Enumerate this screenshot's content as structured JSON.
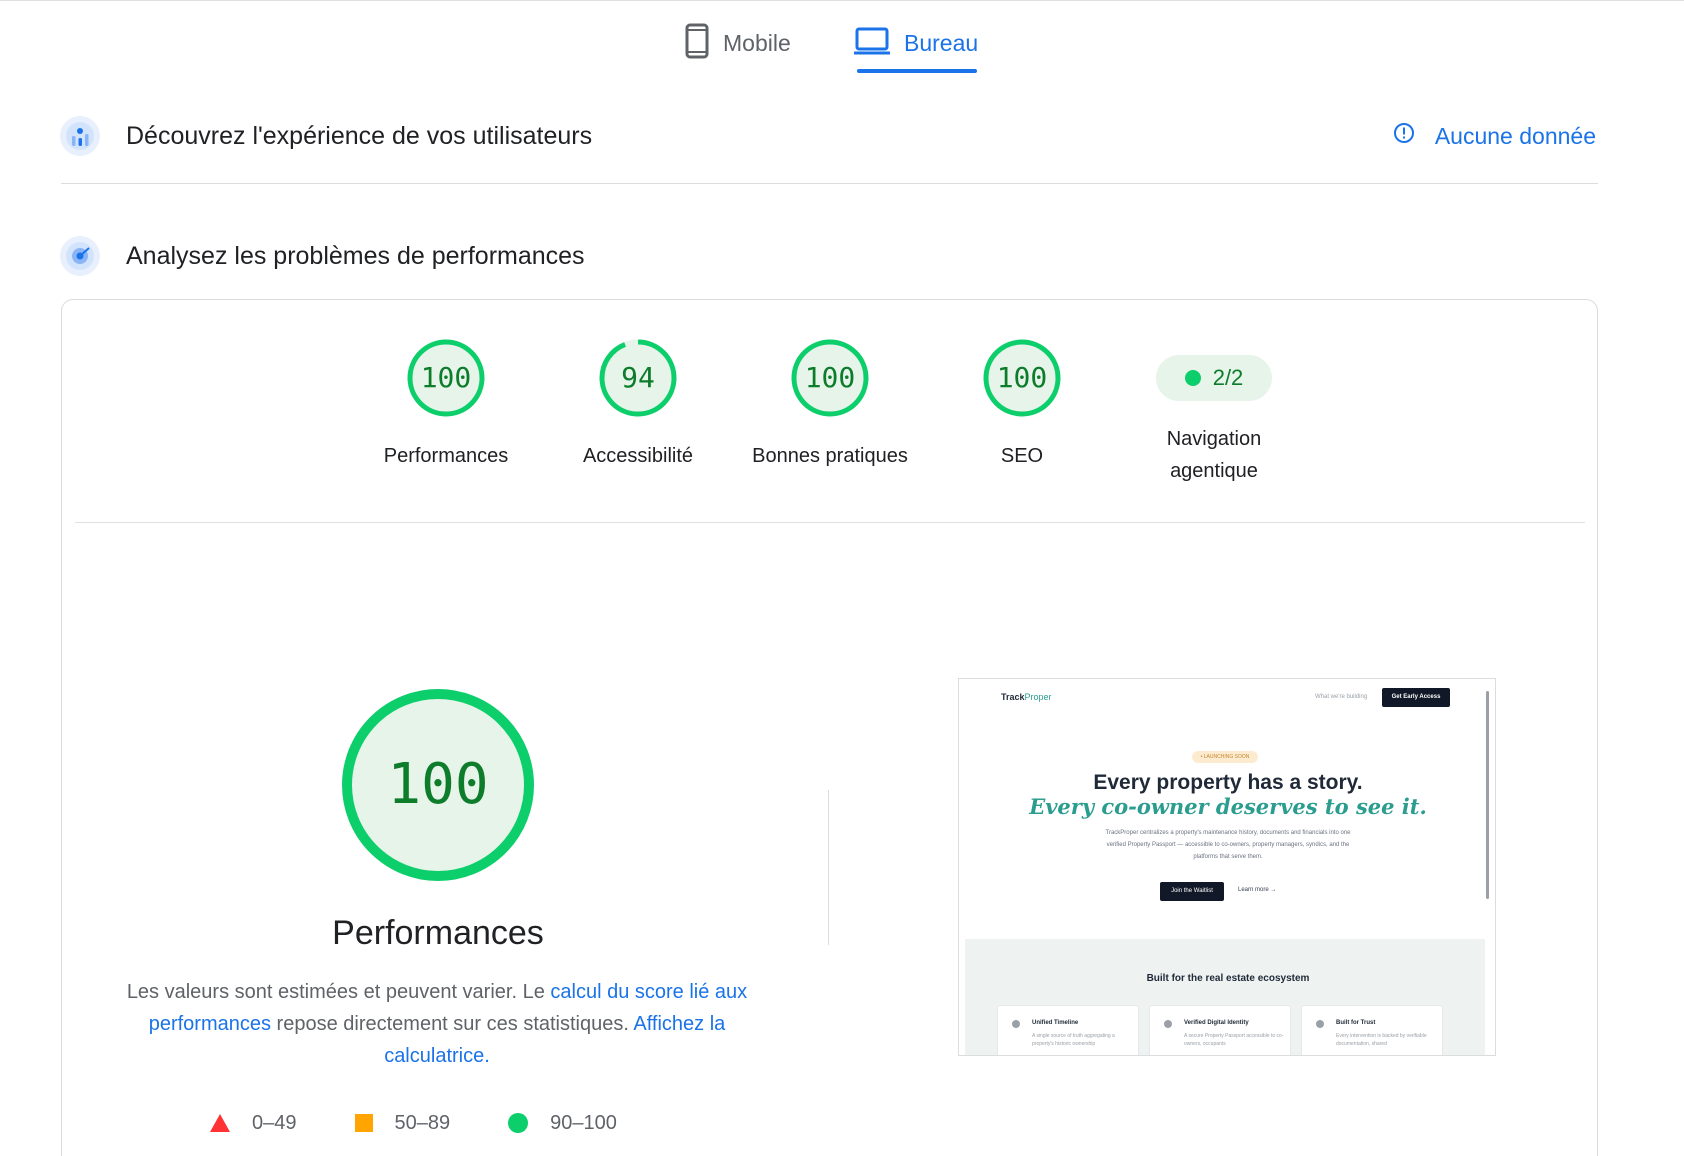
{
  "tabs": {
    "mobile_label": "Mobile",
    "desktop_label": "Bureau",
    "active": "Bureau"
  },
  "sections": {
    "experience_title": "Découvrez l'expérience de vos utilisateurs",
    "no_data_label": "Aucune donnée",
    "diagnose_title": "Analysez les problèmes de performances"
  },
  "scores": [
    {
      "value": "100",
      "label": "Performances",
      "fraction": 1.0
    },
    {
      "value": "94",
      "label": "Accessibilité",
      "fraction": 0.94
    },
    {
      "value": "100",
      "label": "Bonnes pratiques",
      "fraction": 1.0
    },
    {
      "value": "100",
      "label": "SEO",
      "fraction": 1.0
    }
  ],
  "agentic": {
    "value": "2/2",
    "label_line1": "Navigation",
    "label_line2": "agentique"
  },
  "performance": {
    "score": "100",
    "title": "Performances",
    "desc_1": "Les valeurs sont estimées et peuvent varier. Le ",
    "link_1": "calcul du score lié aux performances",
    "desc_2": " repose directement sur ces statistiques. ",
    "link_2": "Affichez la calculatrice."
  },
  "legend": {
    "fail": "0–49",
    "average": "50–89",
    "pass": "90–100"
  },
  "thumbnail": {
    "logo_brand": "Track",
    "logo_suffix": "Proper",
    "nav_link": "What we're building",
    "nav_button": "Get Early Access",
    "badge": "• LAUNCHING SOON",
    "headline": "Every property has a story.",
    "headline_accent": "Every co-owner deserves to see it.",
    "paragraph": "TrackProper centralizes a property's maintenance history, documents and financials into one verified Property Passport — accessible to co-owners, property managers, syndics, and the platforms that serve them.",
    "cta": "Join the Waitlist",
    "learn_more": "Learn more →",
    "section_title": "Built for the real estate ecosystem",
    "features": [
      {
        "title": "Unified Timeline",
        "text": "A single source of truth aggregating a property's historic ownership"
      },
      {
        "title": "Verified Digital Identity",
        "text": "A secure Property Passport accessible to co-owners, occupants"
      },
      {
        "title": "Built for Trust",
        "text": "Every intervention is backed by verifiable documentation, shared"
      }
    ]
  },
  "colors": {
    "accent": "#1a73e8",
    "pass": "#0cce6b",
    "pass_text": "#0d7c2b",
    "average": "#ffa400",
    "fail": "#ff3333"
  }
}
